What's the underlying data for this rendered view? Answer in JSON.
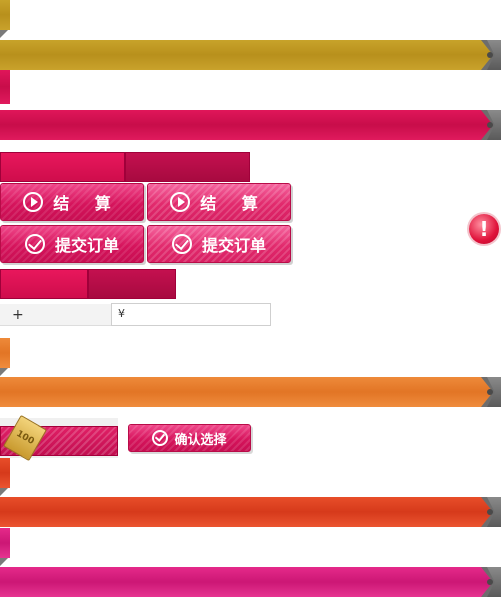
{
  "colors": {
    "gold": "#c8a32a",
    "crimson": "#e0165a",
    "orange": "#ee8a3a",
    "red_orange": "#e84e2a",
    "magenta": "#e52a8a",
    "pink_button": "#d6145c"
  },
  "buttons": {
    "checkout_label": "结 算",
    "submit_order_label": "提交订单",
    "confirm_selection_label": "确认选择"
  },
  "icons": {
    "play": "play-circle-icon",
    "check": "check-circle-icon",
    "alert": "alert-icon",
    "plus": "plus-icon",
    "coupon": "coupon-ticket-icon"
  },
  "form": {
    "plus_symbol": "+",
    "currency_symbol": "¥"
  },
  "coupon": {
    "value": "100"
  },
  "alert": {
    "symbol": "!"
  }
}
